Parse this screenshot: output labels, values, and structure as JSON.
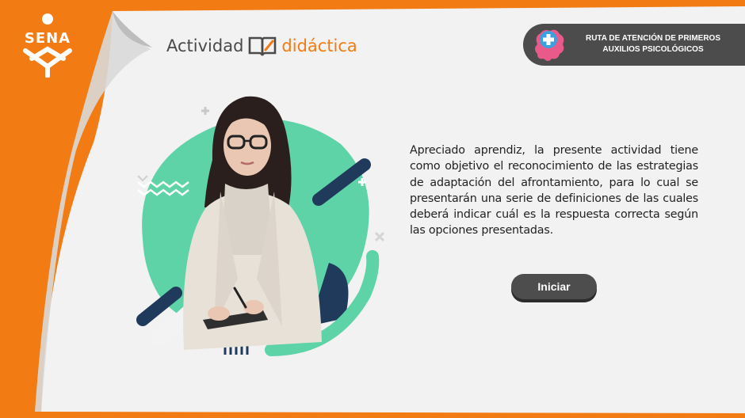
{
  "brand": {
    "logo_text": "SENA"
  },
  "header": {
    "title_left": "Actividad",
    "title_right": "didáctica",
    "route_label": "RUTA DE ATENCIÓN DE PRIMEROS AUXILIOS PSICOLÓGICOS"
  },
  "main": {
    "description": "Apreciado aprendiz, la presente actividad tiene como objetivo el reconocimiento de las estrategias de adaptación del afrontamiento, para lo cual se presentarán una serie de definiciones de las cuales deberá indicar cuál es la respuesta correcta según las opciones presentadas.",
    "start_label": "Iniciar"
  },
  "icons": {
    "logo": "sena-logo",
    "title": "book-pencil-icon",
    "route": "brain-first-aid-icon",
    "illustration": "woman-with-clipboard-illustration"
  },
  "colors": {
    "background": "#f27b13",
    "card": "#f2f2f2",
    "accent_orange": "#f27b13",
    "accent_green": "#5fd3a8",
    "navy": "#1f3a5a",
    "dark_button": "#4d4d4d"
  }
}
